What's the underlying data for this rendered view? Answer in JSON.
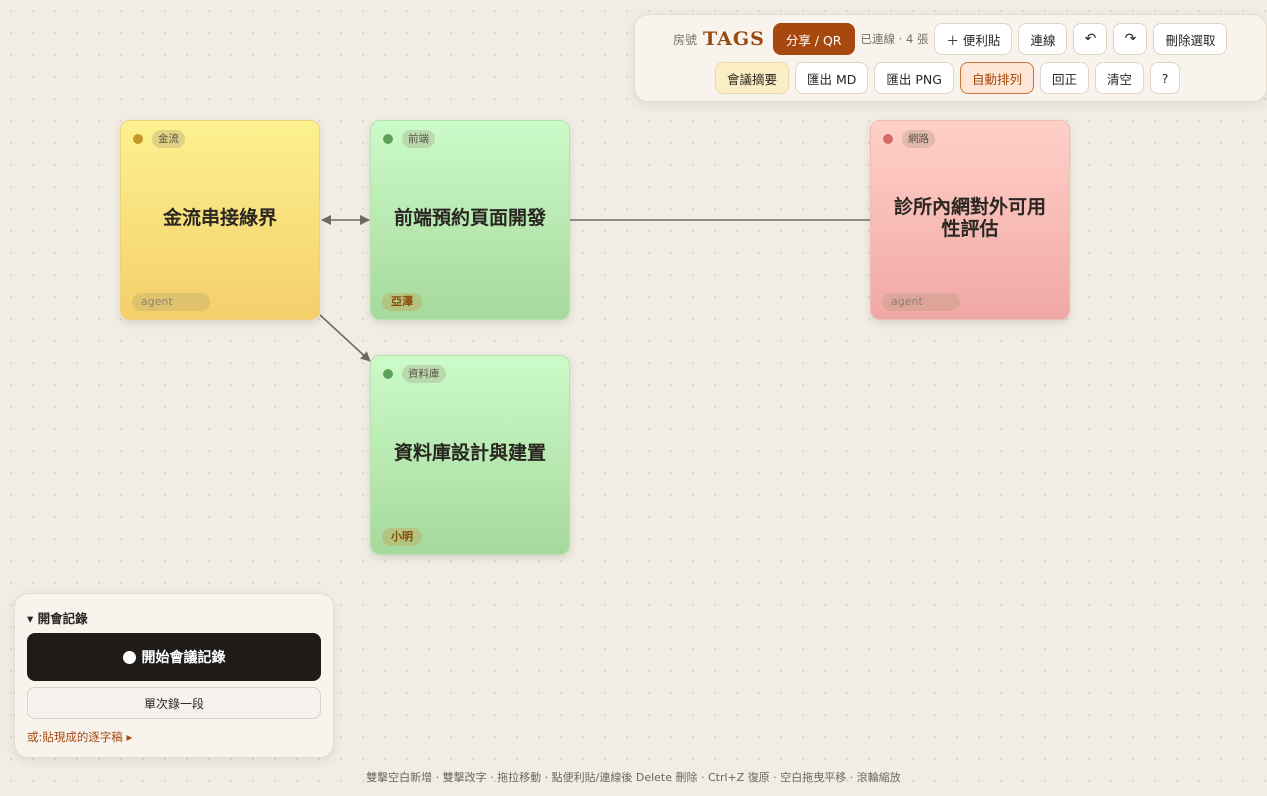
{
  "toolbar": {
    "room_label": "房號",
    "room_code": "TAGS",
    "share_label": "分享 / QR",
    "status": "已連線 · 4 張",
    "add_note_label": "＋ 便利貼",
    "connect_label": "連線",
    "undo_glyph": "↶",
    "redo_glyph": "↷",
    "delete_selected_label": "刪除選取",
    "summary_label": "會議摘要",
    "export_md_label": "匯出 MD",
    "export_png_label": "匯出 PNG",
    "auto_arrange_label": "自動排列",
    "reset_view_label": "回正",
    "clear_label": "清空",
    "help_label": "?"
  },
  "notes": [
    {
      "tag": "金流",
      "title": "金流串接綠界",
      "author": "agent",
      "color": "#fdf18f"
    },
    {
      "tag": "前端",
      "title": "前端預約頁面開發",
      "author": "亞澤",
      "color": "#cbfbc9"
    },
    {
      "tag": "網路",
      "title": "診所內網對外可用性評估",
      "author": "agent",
      "color": "#ffd0c8"
    },
    {
      "tag": "資料庫",
      "title": "資料庫設計與建置",
      "author": "小明",
      "color": "#cbfbc9"
    }
  ],
  "meeting": {
    "title": "▾ 開會記錄",
    "start_label": "開始會議記錄",
    "single_label": "單次錄一段",
    "paste_label": "或:貼現成的逐字稿 ▸"
  },
  "hint": "雙擊空白新增 · 雙擊改字 · 拖拉移動 · 點便利貼/連線後 Delete 刪除 · Ctrl+Z 復原 · 空白拖曳平移 · 滾輪縮放",
  "colors": {
    "accent": "#a7480f",
    "background": "#f1ede4",
    "note_yellow": "#fdf18f",
    "note_green": "#cbfbc9",
    "note_red": "#ffd0c8"
  }
}
